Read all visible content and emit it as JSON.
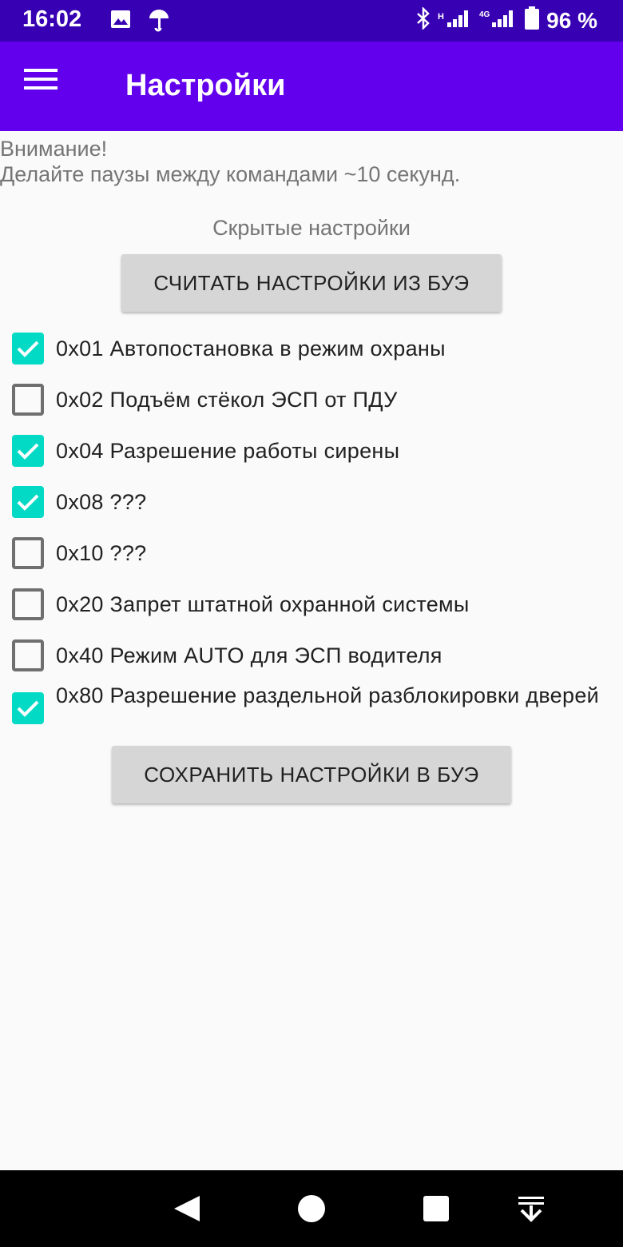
{
  "status_bar": {
    "time": "16:02",
    "battery_percent": "96 %",
    "icons": [
      "image-icon",
      "umbrella-icon",
      "bluetooth-icon",
      "signal-h-icon",
      "signal-4g-icon",
      "battery-icon"
    ]
  },
  "app_bar": {
    "title": "Настройки",
    "menu_icon": "hamburger-menu-icon",
    "background": "#6200ee"
  },
  "warning": {
    "line1": "Внимание!",
    "line2": "Делайте паузы между командами ~10 секунд."
  },
  "hidden_settings_label": "Скрытые настройки",
  "read_button_label": "СЧИТАТЬ НАСТРОЙКИ ИЗ БУЭ",
  "save_button_label": "СОХРАНИТЬ НАСТРОЙКИ В БУЭ",
  "settings": [
    {
      "label": "0x01 Автопостановка в режим охраны",
      "checked": true
    },
    {
      "label": "0x02 Подъём стёкол ЭСП от ПДУ",
      "checked": false
    },
    {
      "label": "0x04 Разрешение работы сирены",
      "checked": true
    },
    {
      "label": "0x08 ???",
      "checked": true
    },
    {
      "label": "0x10 ???",
      "checked": false
    },
    {
      "label": "0x20 Запрет штатной охранной системы",
      "checked": false
    },
    {
      "label": "0x40 Режим AUTO для ЭСП водителя",
      "checked": false
    },
    {
      "label": "0x80 Разрешение раздельной разблокировки дверей",
      "checked": true
    }
  ],
  "colors": {
    "status_bar": "#3700b3",
    "app_bar": "#6200ee",
    "checkbox_checked": "#03dac5",
    "checkbox_unchecked": "#6f6f6f"
  },
  "nav_bar": {
    "icons": [
      "back-icon",
      "home-icon",
      "recents-icon",
      "notifications-pull-icon"
    ]
  }
}
